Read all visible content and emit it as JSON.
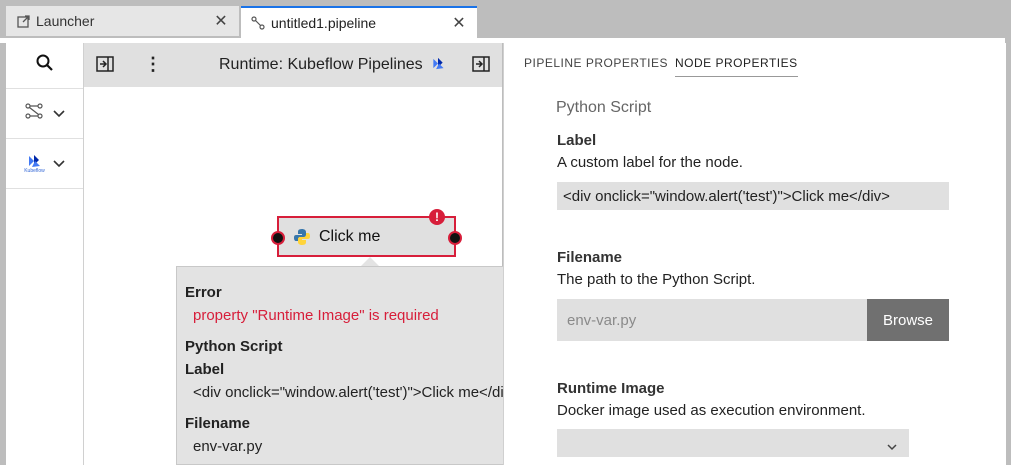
{
  "tabs": [
    {
      "label": "Launcher",
      "icon": "external-link-icon"
    },
    {
      "label": "untitled1.pipeline",
      "icon": "pipeline-icon"
    }
  ],
  "toolbar": {
    "runtime_label": "Runtime: Kubeflow Pipelines"
  },
  "sidebar": {
    "items": [
      {
        "icon": "search-icon"
      },
      {
        "icon": "pipeline-components-icon"
      },
      {
        "icon": "kubeflow-icon",
        "caption": "Kubeflow"
      }
    ]
  },
  "node": {
    "label": "Click me",
    "error_badge": "!"
  },
  "tooltip": {
    "error_heading": "Error",
    "error_message": "property \"Runtime Image\" is required",
    "type_heading": "Python Script",
    "label_heading": "Label",
    "label_value": "<div onclick=\"window.alert('test')\">Click me</div>",
    "filename_heading": "Filename",
    "filename_value": "env-var.py"
  },
  "properties": {
    "tabs": [
      "PIPELINE PROPERTIES",
      "NODE PROPERTIES"
    ],
    "active_tab": "NODE PROPERTIES",
    "section_title": "Python Script",
    "label_field": {
      "title": "Label",
      "description": "A custom label for the node.",
      "value": "<div onclick=\"window.alert('test')\">Click me</div>"
    },
    "filename_field": {
      "title": "Filename",
      "description": "The path to the Python Script.",
      "placeholder": "env-var.py",
      "browse_label": "Browse"
    },
    "runtime_image_field": {
      "title": "Runtime Image",
      "description": "Docker image used as execution environment.",
      "value": ""
    }
  },
  "colors": {
    "accent": "#1a73e8",
    "error": "#d71e3a"
  }
}
